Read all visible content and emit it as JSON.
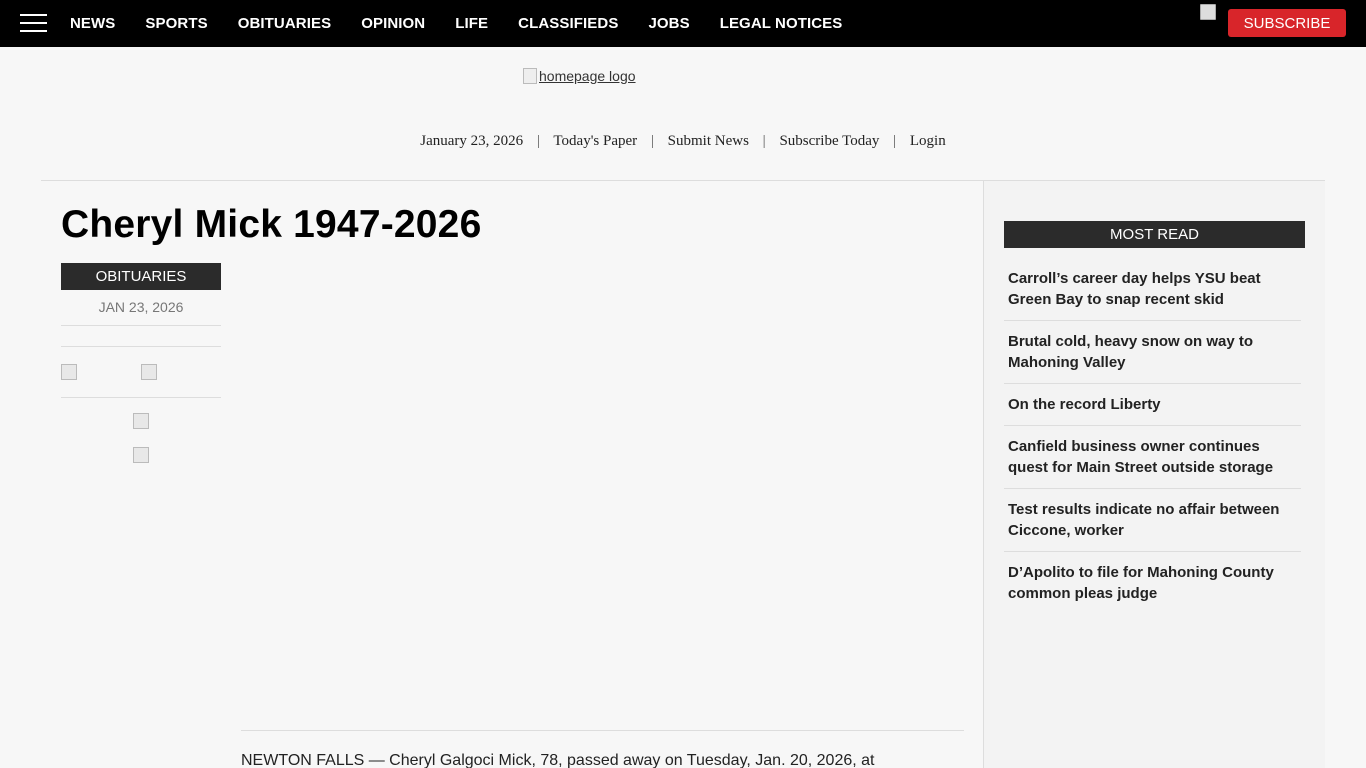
{
  "nav": {
    "items": [
      "NEWS",
      "SPORTS",
      "OBITUARIES",
      "OPINION",
      "LIFE",
      "CLASSIFIEDS",
      "JOBS",
      "LEGAL NOTICES"
    ],
    "subscribe_label": "SUBSCRIBE",
    "menu_icon": "hamburger-menu-icon"
  },
  "header": {
    "logo_alt": "homepage logo",
    "date": "January 23, 2026",
    "links": [
      "Today's Paper",
      "Submit News",
      "Subscribe Today",
      "Login"
    ]
  },
  "article": {
    "title": "Cheryl Mick 1947-2026",
    "category": "OBITUARIES",
    "date": "JAN 23, 2026",
    "body_start": "NEWTON FALLS — Cheryl Galgoci Mick, 78, passed away on Tuesday, Jan. 20, 2026, at"
  },
  "most_read": {
    "title": "MOST READ",
    "items": [
      "Carroll’s career day helps YSU beat Green Bay to snap recent skid",
      "Brutal cold, heavy snow on way to Mahoning Valley",
      "On the record Liberty",
      "Canfield business owner continues quest for Main Street outside storage",
      "Test results indicate no affair between Ciccone, worker",
      "D’Apolito to file for Mahoning County common pleas judge"
    ]
  },
  "colors": {
    "nav_bg": "#000000",
    "subscribe_red": "#d8252a",
    "badge_dark": "#2b2b2b",
    "page_bg": "#f7f7f7"
  }
}
